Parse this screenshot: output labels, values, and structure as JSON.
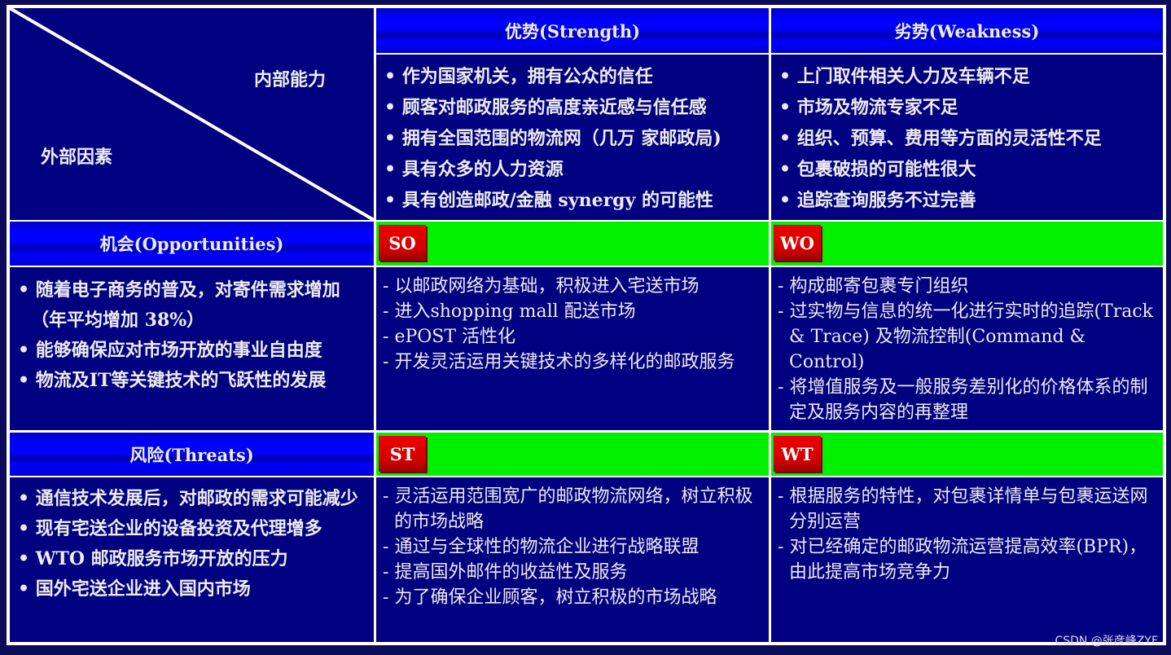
{
  "corner": {
    "internal": "内部能力",
    "external": "外部因素"
  },
  "headers": {
    "strength": "优势(Strength)",
    "weakness": "劣势(Weakness)",
    "opportunities": "机会(Opportunities)",
    "threats": "风险(Threats)"
  },
  "strengths": [
    "作为国家机关，拥有公众的信任",
    "顾客对邮政服务的高度亲近感与信任感",
    "拥有全国范围的物流网（几万 家邮政局)",
    "具有众多的人力资源",
    "具有创造邮政/金融 synergy 的可能性"
  ],
  "weaknesses": [
    "上门取件相关人力及车辆不足",
    "市场及物流专家不足",
    "组织、预算、费用等方面的灵活性不足",
    "包裹破损的可能性很大",
    "追踪查询服务不过完善"
  ],
  "opportunities": [
    "随着电子商务的普及，对寄件需求增加 （年平均增加 38%）",
    "能够确保应对市场开放的事业自由度",
    "物流及IT等关键技术的飞跃性的发展"
  ],
  "threats": [
    "通信技术发展后，对邮政的需求可能减少",
    "现有宅送企业的设备投资及代理增多",
    "WTO 邮政服务市场开放的压力",
    "国外宅送企业进入国内市场"
  ],
  "strategies": {
    "so": {
      "label": "SO",
      "items": [
        "以邮政网络为基础，积极进入宅送市场",
        "进入shopping mall 配送市场",
        "ePOST 活性化",
        "开发灵活运用关键技术的多样化的邮政服务"
      ]
    },
    "wo": {
      "label": "WO",
      "items": [
        "构成邮寄包裹专门组织",
        "过实物与信息的统一化进行实时的追踪(Track & Trace) 及物流控制(Command & Control)",
        "将增值服务及一般服务差别化的价格体系的制定及服务内容的再整理"
      ]
    },
    "st": {
      "label": "ST",
      "items": [
        "灵活运用范围宽广的邮政物流网络，树立积极的市场战略",
        "通过与全球性的物流企业进行战略联盟",
        "提高国外邮件的收益性及服务",
        "为了确保企业顾客，树立积极的市场战略"
      ]
    },
    "wt": {
      "label": "WT",
      "items": [
        "根据服务的特性，对包裹详情单与包裹运送网分别运营",
        "对已经确定的邮政物流运营提高效率(BPR)，由此提高市场竞争力"
      ]
    }
  },
  "colors": {
    "cell": "#000080",
    "header": "#0000ff",
    "bar": "#00f000",
    "badge": "#dd0000"
  },
  "watermark": "CSDN @张彦峰ZYF"
}
